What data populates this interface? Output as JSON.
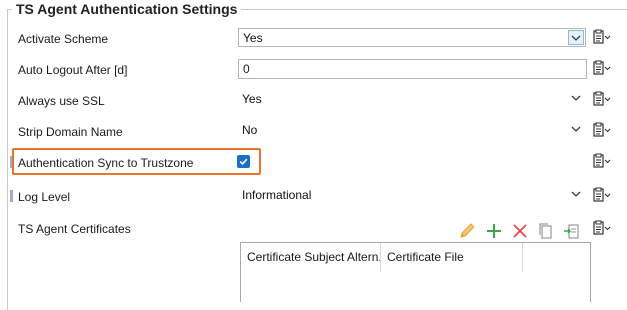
{
  "panel": {
    "title": "TS Agent Authentication Settings"
  },
  "rows": {
    "activate_scheme": {
      "label": "Activate Scheme",
      "value": "Yes"
    },
    "auto_logout": {
      "label": "Auto Logout After [d]",
      "value": "0"
    },
    "always_ssl": {
      "label": "Always use SSL",
      "value": "Yes"
    },
    "strip_domain": {
      "label": "Strip Domain Name",
      "value": "No"
    },
    "auth_sync": {
      "label": "Authentication Sync to Trustzone",
      "checked": true
    },
    "log_level": {
      "label": "Log Level",
      "value": "Informational"
    },
    "certificates": {
      "label": "TS Agent Certificates"
    }
  },
  "certificate_table": {
    "columns": [
      "Certificate Subject Altern...",
      "Certificate File"
    ]
  },
  "colors": {
    "highlight": "#e8742e",
    "checkbox": "#1c6ec9",
    "add": "#3aa64a",
    "delete": "#e0464e",
    "edit": "#e8a83a"
  },
  "icons": {
    "row_action": "clipboard-icon",
    "edit": "pencil-icon",
    "add": "plus-icon",
    "delete": "x-icon",
    "copy": "copy-icon",
    "import": "import-icon"
  }
}
